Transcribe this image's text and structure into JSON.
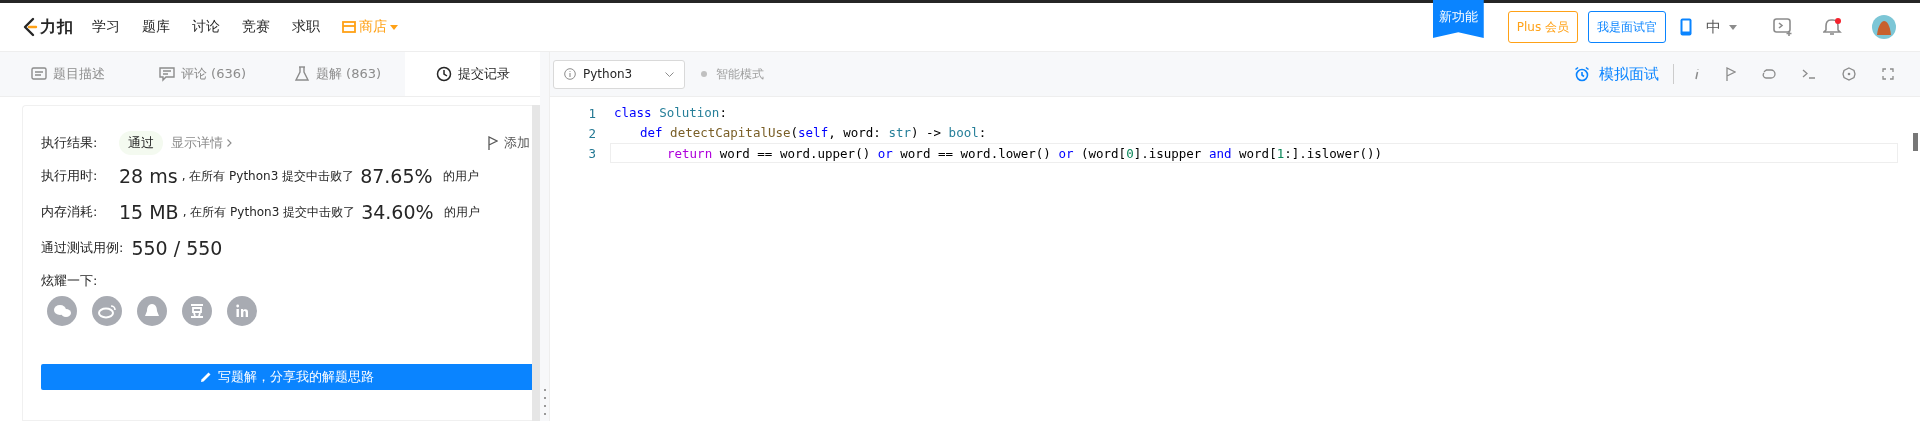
{
  "topbar": {
    "logo_text": "力扣",
    "nav": [
      {
        "label": "学习",
        "kind": "plain"
      },
      {
        "label": "题库",
        "kind": "plain"
      },
      {
        "label": "讨论",
        "kind": "plain"
      },
      {
        "label": "竞赛",
        "kind": "plain"
      },
      {
        "label": "求职",
        "kind": "plain"
      },
      {
        "label": "商店",
        "kind": "shop"
      }
    ],
    "ribbon": "新功能",
    "plus_button": "Plus 会员",
    "interviewer_button": "我是面试官",
    "language": "中",
    "language_menu_expanded": false,
    "notification_dot": true
  },
  "tabs": [
    {
      "label": "题目描述",
      "selected": false
    },
    {
      "label": "评论 (636)",
      "selected": false
    },
    {
      "label": "题解 (863)",
      "selected": false
    },
    {
      "label": "提交记录",
      "selected": true
    }
  ],
  "result": {
    "label": "执行结果:",
    "status": "通过",
    "details_link": "显示详情",
    "add_note": "添加",
    "stats": [
      {
        "label": "执行用时:",
        "value": "28 ms",
        "text": ", 在所有 Python3 提交中击败了",
        "percent": "87.65%",
        "suffix": "的用户"
      },
      {
        "label": "内存消耗:",
        "value": "15 MB",
        "text": ", 在所有 Python3 提交中击败了",
        "percent": "34.60%",
        "suffix": "的用户"
      }
    ],
    "tests_label": "通过测试用例:",
    "tests_value": "550 / 550",
    "share_label": "炫耀一下:",
    "share": [
      {
        "kind": "wechat"
      },
      {
        "kind": "weibo"
      },
      {
        "kind": "qq"
      },
      {
        "kind": "douban"
      },
      {
        "kind": "linkedin"
      }
    ],
    "write_button": "写题解，分享我的解题思路"
  },
  "editor": {
    "language": "Python3",
    "smart_mode": "智能模式",
    "mock_interview": "模拟面试",
    "lines": [
      {
        "number": "1",
        "current": false,
        "tokens": [
          {
            "t": "class ",
            "kind": "keyword"
          },
          {
            "t": "Solution",
            "kind": "type"
          },
          {
            "t": ":",
            "kind": "plain"
          }
        ],
        "children": [
          {
            "number": "2",
            "current": false,
            "tokens": [
              {
                "t": "def ",
                "kind": "keyword"
              },
              {
                "t": "detectCapitalUse",
                "kind": "function"
              },
              {
                "t": "(",
                "kind": "plain"
              },
              {
                "t": "self",
                "kind": "keyword"
              },
              {
                "t": ", word: ",
                "kind": "plain"
              },
              {
                "t": "str",
                "kind": "type"
              },
              {
                "t": ") -> ",
                "kind": "plain"
              },
              {
                "t": "bool",
                "kind": "type"
              },
              {
                "t": ":",
                "kind": "plain"
              }
            ],
            "children": [
              {
                "number": "3",
                "current": true,
                "tokens": [
                  {
                    "t": "return",
                    "kind": "control"
                  },
                  {
                    "t": " word == word.upper() ",
                    "kind": "plain"
                  },
                  {
                    "t": "or",
                    "kind": "keyword"
                  },
                  {
                    "t": " word == word.lower() ",
                    "kind": "plain"
                  },
                  {
                    "t": "or",
                    "kind": "keyword"
                  },
                  {
                    "t": " (word[",
                    "kind": "plain"
                  },
                  {
                    "t": "0",
                    "kind": "number"
                  },
                  {
                    "t": "].isupper ",
                    "kind": "plain"
                  },
                  {
                    "t": "and",
                    "kind": "keyword"
                  },
                  {
                    "t": " word[",
                    "kind": "plain"
                  },
                  {
                    "t": "1",
                    "kind": "number"
                  },
                  {
                    "t": ":].islower())",
                    "kind": "plain"
                  }
                ]
              }
            ]
          }
        ]
      }
    ]
  }
}
